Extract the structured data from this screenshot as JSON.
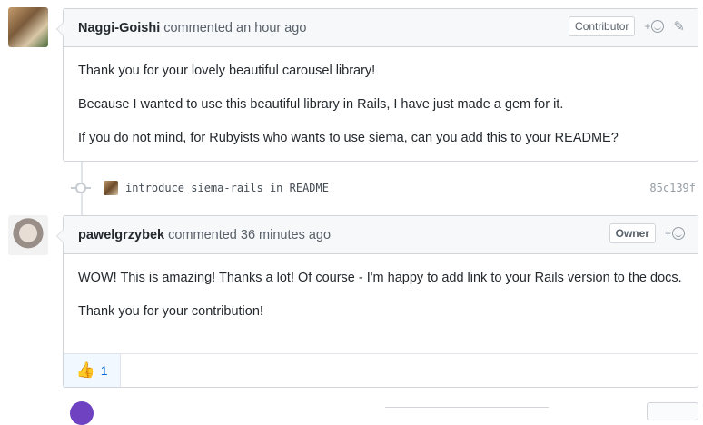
{
  "comments": [
    {
      "author": "Naggi-Goishi",
      "action": "commented",
      "time": "an hour ago",
      "role": "Contributor",
      "paragraphs": [
        "Thank you for your lovely beautiful carousel library!",
        "Because I wanted to use this beautiful library in Rails, I have just made a gem for it.",
        "If you do not mind, for Rubyists who wants to use siema, can you add this to your README?"
      ]
    },
    {
      "author": "pawelgrzybek",
      "action": "commented",
      "time": "36 minutes ago",
      "role": "Owner",
      "paragraphs": [
        "WOW! This is amazing! Thanks a lot! Of course - I'm happy to add link to your Rails version to the docs.",
        "Thank you for your contribution!"
      ],
      "reaction": {
        "icon": "thumbs-up-icon",
        "glyph": "👍",
        "count": "1"
      }
    }
  ],
  "commit": {
    "message": "introduce siema-rails in README",
    "sha": "85c139f"
  },
  "icons": {
    "add_reaction_plus": "+",
    "pencil": "✎"
  },
  "colors": {
    "header_bg": "#f6f8fa",
    "border": "#d1d5da",
    "link": "#0366d6",
    "reaction_bg": "#f1f8ff"
  }
}
